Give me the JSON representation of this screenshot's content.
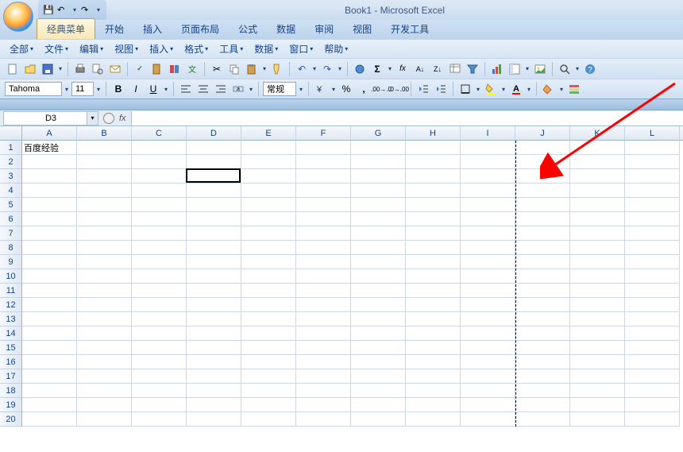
{
  "title": "Book1 - Microsoft Excel",
  "qat": {
    "save": "💾",
    "undo": "↶",
    "redo": "↷"
  },
  "tabs": [
    "经典菜单",
    "开始",
    "插入",
    "页面布局",
    "公式",
    "数据",
    "审阅",
    "视图",
    "开发工具"
  ],
  "active_tab_index": 0,
  "menubar": [
    "全部",
    "文件",
    "编辑",
    "视图",
    "插入",
    "格式",
    "工具",
    "数据",
    "窗口",
    "帮助"
  ],
  "font": {
    "name": "Tahoma",
    "size": "11"
  },
  "number_format": "常规",
  "namebox": "D3",
  "formula": "",
  "columns": [
    "A",
    "B",
    "C",
    "D",
    "E",
    "F",
    "G",
    "H",
    "I",
    "J",
    "K",
    "L"
  ],
  "row_count": 20,
  "cells": {
    "A1": "百度经验"
  },
  "active_cell": {
    "row": 3,
    "col": "D",
    "col_index": 3
  },
  "page_break_after_col_index": 9,
  "toolbar_icons": {
    "new": "new-doc-icon",
    "open": "open-icon",
    "save": "save-icon",
    "print": "print-icon",
    "printpreview": "print-preview-icon",
    "email": "email-icon",
    "spell": "spellcheck-icon",
    "research": "research-icon",
    "thesaurus": "thesaurus-icon",
    "translate": "translate-icon",
    "cut": "cut-icon",
    "copy": "copy-icon",
    "paste": "paste-icon",
    "formatpainter": "format-painter-icon",
    "undo": "undo-icon",
    "redo": "redo-icon",
    "sortasc": "sort-asc-icon",
    "autosum": "autosum-icon",
    "function": "fx-icon",
    "sortza": "sort-desc-icon",
    "filter": "filter-icon",
    "chart": "chart-icon",
    "pivottable": "pivot-icon",
    "table": "table-icon",
    "picture": "picture-icon",
    "zoom": "zoom-icon",
    "help": "help-icon",
    "bold": "B",
    "italic": "I",
    "underline": "U",
    "alignl": "align-left-icon",
    "alignc": "align-center-icon",
    "alignr": "align-right-icon",
    "merge": "merge-icon",
    "currency": "currency-icon",
    "percent": "%",
    "comma": ",",
    "incdec": "increase-decimal-icon",
    "decdec": "decrease-decimal-icon",
    "indentdec": "decrease-indent-icon",
    "indentinc": "increase-indent-icon",
    "borders": "borders-icon",
    "fill": "fill-color-icon",
    "fontcolor": "font-color-icon",
    "paintbucket": "paint-bucket-icon",
    "conditional": "conditional-format-icon"
  }
}
